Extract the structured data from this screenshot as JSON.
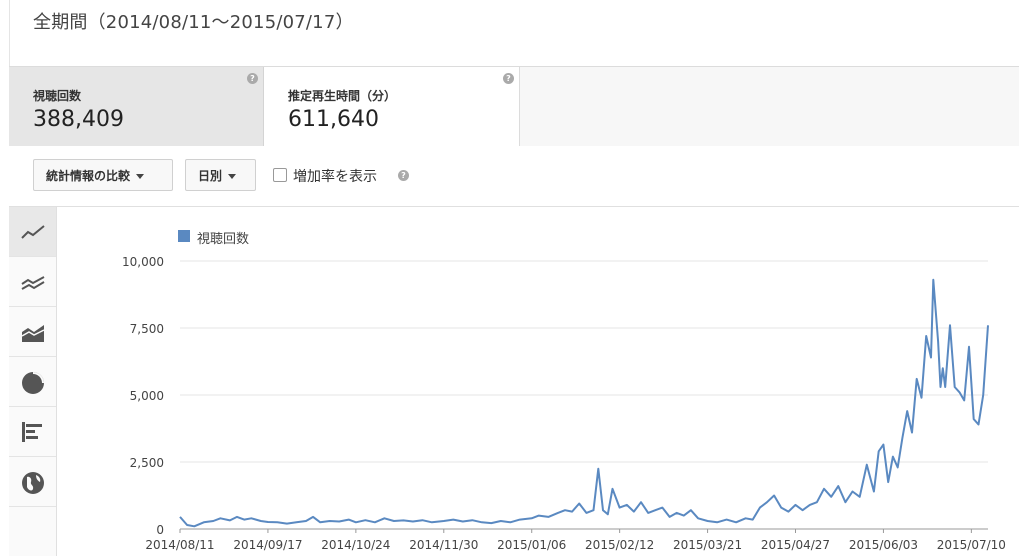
{
  "header": {
    "period_title": "全期間（2014/08/11～2015/07/17）"
  },
  "metrics": [
    {
      "label": "視聴回数",
      "value": "388,409",
      "selected": true
    },
    {
      "label": "推定再生時間（分）",
      "value": "611,640",
      "selected": false
    }
  ],
  "controls": {
    "compare_label": "統計情報の比較",
    "granularity_label": "日別",
    "growth_checkbox_label": "増加率を表示",
    "growth_checked": false
  },
  "chart_type_buttons": [
    {
      "icon": "line-chart-icon",
      "active": true
    },
    {
      "icon": "multi-line-chart-icon",
      "active": false
    },
    {
      "icon": "area-chart-icon",
      "active": false
    },
    {
      "icon": "pie-chart-icon",
      "active": false
    },
    {
      "icon": "bar-chart-icon",
      "active": false
    },
    {
      "icon": "globe-icon",
      "active": false
    }
  ],
  "colors": {
    "series": "#5a89c1",
    "selected_metric_bg": "#e6e6e6"
  },
  "chart_data": {
    "type": "line",
    "ylim": [
      0,
      10000
    ],
    "yticks": [
      0,
      2500,
      5000,
      7500,
      10000
    ],
    "ytick_labels": [
      "0",
      "2,500",
      "5,000",
      "7,500",
      "10,000"
    ],
    "xticks": [
      "2014/08/11",
      "2014/09/17",
      "2014/10/24",
      "2014/11/30",
      "2015/01/06",
      "2015/02/12",
      "2015/03/21",
      "2015/04/27",
      "2015/06/03",
      "2015/07/10"
    ],
    "x_range": [
      "2014/08/11",
      "2015/07/17"
    ],
    "legend": "top-left",
    "grid": true,
    "series": [
      {
        "name": "視聴回数",
        "points": [
          [
            "2014/08/11",
            450
          ],
          [
            "2014/08/14",
            150
          ],
          [
            "2014/08/17",
            100
          ],
          [
            "2014/08/21",
            250
          ],
          [
            "2014/08/25",
            300
          ],
          [
            "2014/08/28",
            400
          ],
          [
            "2014/09/01",
            320
          ],
          [
            "2014/09/04",
            450
          ],
          [
            "2014/09/07",
            350
          ],
          [
            "2014/09/10",
            400
          ],
          [
            "2014/09/14",
            300
          ],
          [
            "2014/09/17",
            260
          ],
          [
            "2014/09/21",
            250
          ],
          [
            "2014/09/25",
            200
          ],
          [
            "2014/09/29",
            250
          ],
          [
            "2014/10/03",
            300
          ],
          [
            "2014/10/06",
            450
          ],
          [
            "2014/10/09",
            250
          ],
          [
            "2014/10/13",
            300
          ],
          [
            "2014/10/17",
            280
          ],
          [
            "2014/10/21",
            350
          ],
          [
            "2014/10/24",
            250
          ],
          [
            "2014/10/28",
            330
          ],
          [
            "2014/11/01",
            250
          ],
          [
            "2014/11/05",
            400
          ],
          [
            "2014/11/09",
            300
          ],
          [
            "2014/11/13",
            320
          ],
          [
            "2014/11/17",
            280
          ],
          [
            "2014/11/21",
            330
          ],
          [
            "2014/11/25",
            250
          ],
          [
            "2014/11/30",
            300
          ],
          [
            "2014/12/04",
            350
          ],
          [
            "2014/12/08",
            280
          ],
          [
            "2014/12/12",
            330
          ],
          [
            "2014/12/16",
            250
          ],
          [
            "2014/12/20",
            220
          ],
          [
            "2014/12/24",
            300
          ],
          [
            "2014/12/28",
            250
          ],
          [
            "2015/01/01",
            350
          ],
          [
            "2015/01/06",
            400
          ],
          [
            "2015/01/09",
            500
          ],
          [
            "2015/01/13",
            450
          ],
          [
            "2015/01/17",
            600
          ],
          [
            "2015/01/20",
            700
          ],
          [
            "2015/01/23",
            650
          ],
          [
            "2015/01/26",
            950
          ],
          [
            "2015/01/29",
            600
          ],
          [
            "2015/02/01",
            700
          ],
          [
            "2015/02/03",
            2250
          ],
          [
            "2015/02/05",
            700
          ],
          [
            "2015/02/07",
            550
          ],
          [
            "2015/02/09",
            1500
          ],
          [
            "2015/02/12",
            800
          ],
          [
            "2015/02/15",
            900
          ],
          [
            "2015/02/18",
            650
          ],
          [
            "2015/02/21",
            1000
          ],
          [
            "2015/02/24",
            600
          ],
          [
            "2015/02/27",
            700
          ],
          [
            "2015/03/02",
            800
          ],
          [
            "2015/03/05",
            450
          ],
          [
            "2015/03/08",
            600
          ],
          [
            "2015/03/11",
            500
          ],
          [
            "2015/03/14",
            700
          ],
          [
            "2015/03/17",
            400
          ],
          [
            "2015/03/21",
            300
          ],
          [
            "2015/03/25",
            250
          ],
          [
            "2015/03/29",
            350
          ],
          [
            "2015/04/02",
            250
          ],
          [
            "2015/04/06",
            400
          ],
          [
            "2015/04/09",
            350
          ],
          [
            "2015/04/12",
            800
          ],
          [
            "2015/04/15",
            1000
          ],
          [
            "2015/04/18",
            1250
          ],
          [
            "2015/04/21",
            800
          ],
          [
            "2015/04/24",
            650
          ],
          [
            "2015/04/27",
            900
          ],
          [
            "2015/04/30",
            700
          ],
          [
            "2015/05/03",
            900
          ],
          [
            "2015/05/06",
            1000
          ],
          [
            "2015/05/09",
            1500
          ],
          [
            "2015/05/12",
            1200
          ],
          [
            "2015/05/15",
            1600
          ],
          [
            "2015/05/18",
            1000
          ],
          [
            "2015/05/21",
            1400
          ],
          [
            "2015/05/24",
            1200
          ],
          [
            "2015/05/27",
            2400
          ],
          [
            "2015/05/30",
            1400
          ],
          [
            "2015/06/01",
            2900
          ],
          [
            "2015/06/03",
            3150
          ],
          [
            "2015/06/05",
            1750
          ],
          [
            "2015/06/07",
            2700
          ],
          [
            "2015/06/09",
            2300
          ],
          [
            "2015/06/11",
            3400
          ],
          [
            "2015/06/13",
            4400
          ],
          [
            "2015/06/15",
            3600
          ],
          [
            "2015/06/17",
            5600
          ],
          [
            "2015/06/19",
            4900
          ],
          [
            "2015/06/21",
            7200
          ],
          [
            "2015/06/23",
            6400
          ],
          [
            "2015/06/24",
            9300
          ],
          [
            "2015/06/26",
            7000
          ],
          [
            "2015/06/27",
            5300
          ],
          [
            "2015/06/28",
            6000
          ],
          [
            "2015/06/29",
            5300
          ],
          [
            "2015/07/01",
            7600
          ],
          [
            "2015/07/03",
            5300
          ],
          [
            "2015/07/05",
            5100
          ],
          [
            "2015/07/07",
            4800
          ],
          [
            "2015/07/09",
            6800
          ],
          [
            "2015/07/11",
            4100
          ],
          [
            "2015/07/13",
            3900
          ],
          [
            "2015/07/15",
            5000
          ],
          [
            "2015/07/17",
            7600
          ]
        ]
      }
    ]
  }
}
